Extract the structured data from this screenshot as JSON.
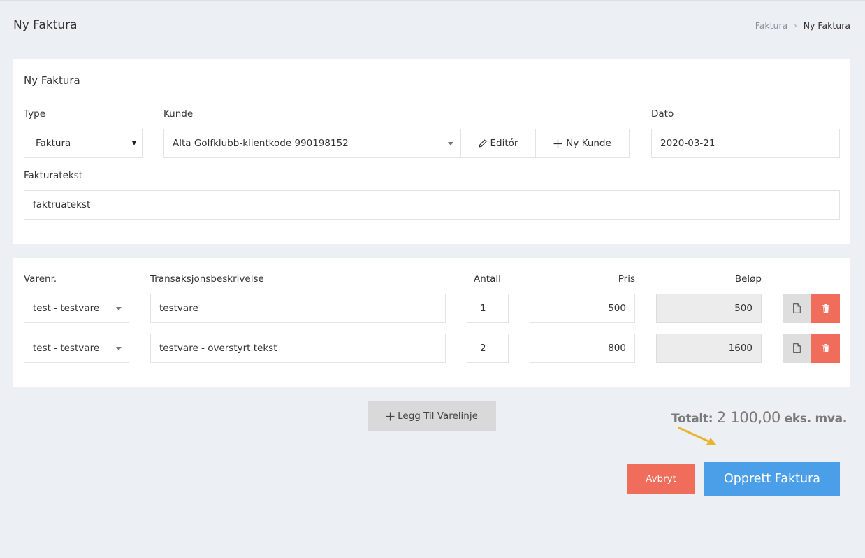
{
  "header": {
    "title": "Ny Faktura",
    "breadcrumb": [
      "Faktura",
      "Ny Faktura"
    ]
  },
  "form": {
    "card_title": "Ny Faktura",
    "type": {
      "label": "Type",
      "value": "Faktura"
    },
    "kunde": {
      "label": "Kunde",
      "value": "Alta Golfklubb-klientkode 990198152",
      "edit_label": "Editór",
      "new_label": "Ny Kunde"
    },
    "dato": {
      "label": "Dato",
      "value": "2020-03-21"
    },
    "fakturatekst": {
      "label": "Fakturatekst",
      "value": "faktruatekst"
    }
  },
  "lines": {
    "headers": {
      "varenr": "Varenr.",
      "beskrivelse": "Transaksjonsbeskrivelse",
      "antall": "Antall",
      "pris": "Pris",
      "belop": "Beløp"
    },
    "rows": [
      {
        "varenr": "test - testvare",
        "beskrivelse": "testvare",
        "antall": "1",
        "pris": "500",
        "belop": "500"
      },
      {
        "varenr": "test - testvare",
        "beskrivelse": "testvare - overstyrt tekst",
        "antall": "2",
        "pris": "800",
        "belop": "1600"
      }
    ]
  },
  "footer": {
    "add_line_label": "Legg Til Varelinje",
    "total_label": "Totalt:",
    "total_amount": "2 100,00",
    "total_suffix": "eks. mva.",
    "cancel_label": "Avbryt",
    "create_label": "Opprett Faktura"
  },
  "colors": {
    "background": "#eceff3",
    "danger": "#ef6d5a",
    "primary": "#4a9fe8",
    "annotation_arrow": "#e8b530"
  },
  "icons": [
    "pencil-icon",
    "plus-icon",
    "file-icon",
    "trash-icon",
    "annotation-arrow-icon"
  ]
}
